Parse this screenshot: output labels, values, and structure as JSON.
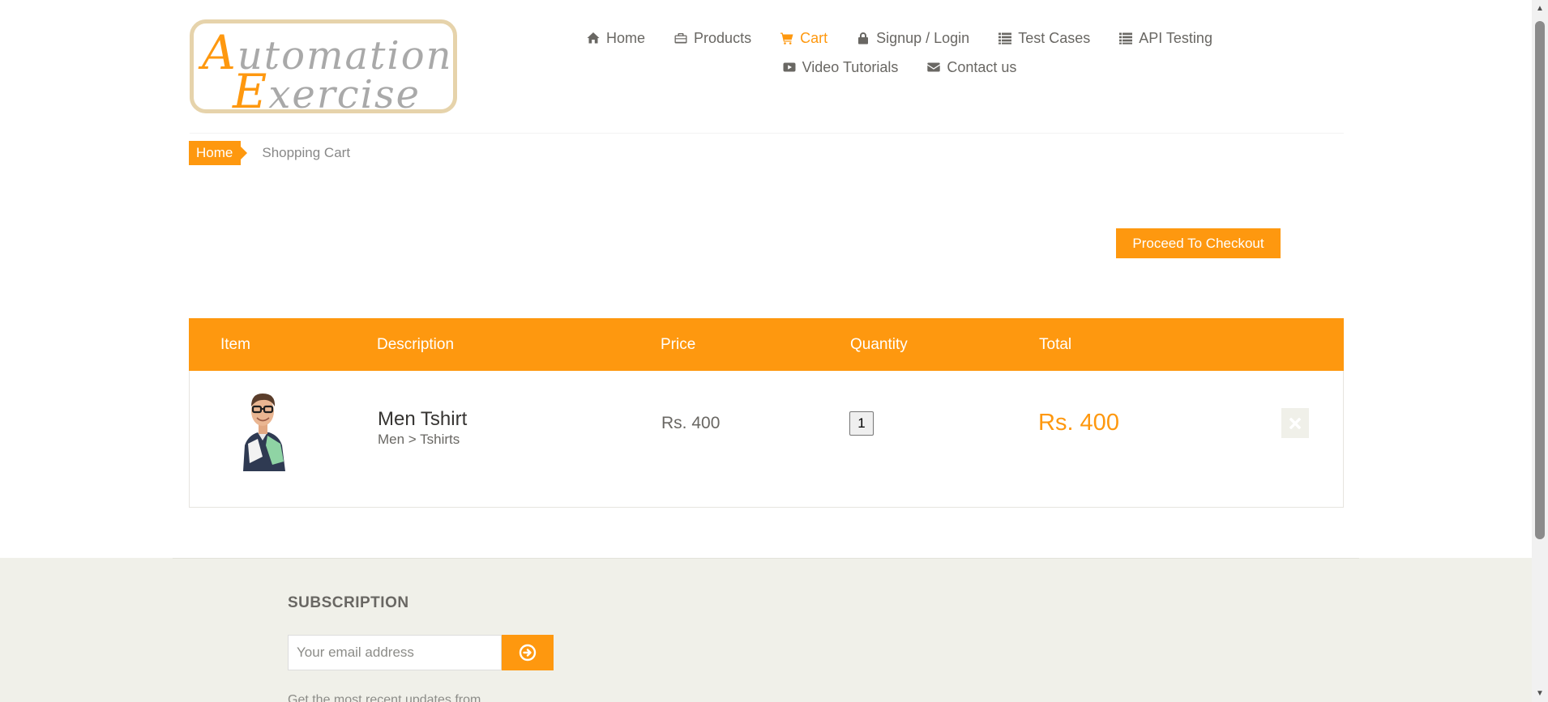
{
  "logo": {
    "line1_first": "A",
    "line1_rest": "utomation",
    "line2_first": "E",
    "line2_rest": "xercise"
  },
  "nav": {
    "home": "Home",
    "products": "Products",
    "cart": "Cart",
    "signup_login": "Signup / Login",
    "test_cases": "Test Cases",
    "api_testing": "API Testing",
    "video_tutorials": "Video Tutorials",
    "contact_us": "Contact us"
  },
  "breadcrumb": {
    "home": "Home",
    "current": "Shopping Cart"
  },
  "checkout_button": "Proceed To Checkout",
  "cart": {
    "headers": {
      "item": "Item",
      "description": "Description",
      "price": "Price",
      "quantity": "Quantity",
      "total": "Total"
    },
    "rows": [
      {
        "name": "Men Tshirt",
        "category": "Men > Tshirts",
        "price": "Rs. 400",
        "quantity": "1",
        "total": "Rs. 400"
      }
    ]
  },
  "footer": {
    "subscription_title": "SUBSCRIPTION",
    "email_placeholder": "Your email address",
    "subscription_text": "Get the most recent updates from"
  },
  "colors": {
    "accent": "#fe980f",
    "text": "#696763",
    "footer_bg": "#f0f0e9"
  },
  "icons": {
    "home": "home-icon",
    "products": "briefcase-icon",
    "cart": "shopping-cart-icon",
    "signup_login": "lock-icon",
    "test_cases": "list-icon",
    "api_testing": "list-icon",
    "video_tutorials": "youtube-play-icon",
    "contact_us": "envelope-icon",
    "delete": "close-icon",
    "subscribe": "arrow-circle-right-icon"
  }
}
